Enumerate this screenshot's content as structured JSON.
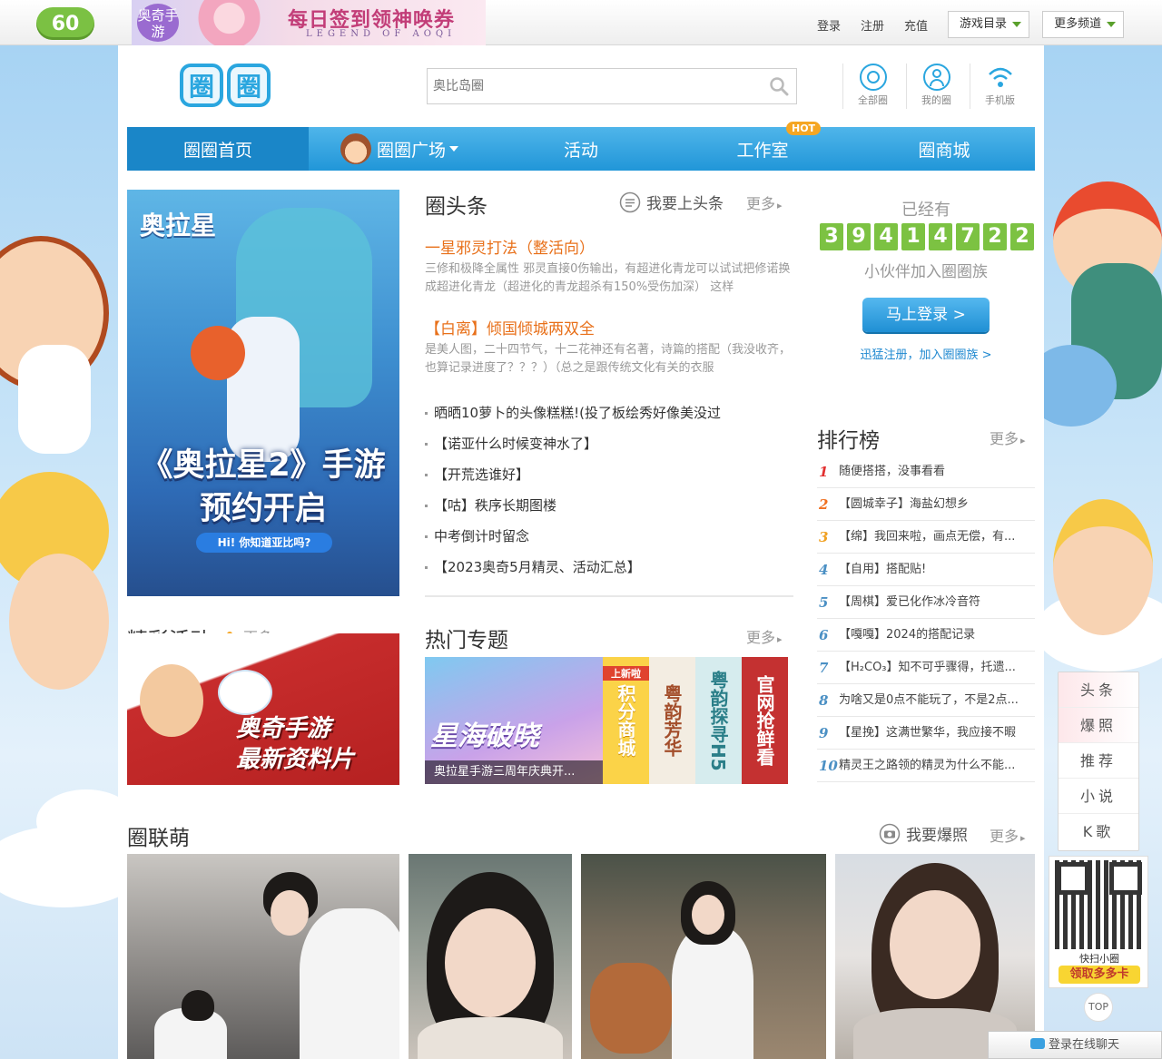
{
  "topbar": {
    "logo_text": "60",
    "banner": {
      "badge": "奥奇手游",
      "slogan": "每日签到领神唤券",
      "sub": "LEGEND OF AOQI"
    },
    "links": [
      "登录",
      "注册",
      "充值"
    ],
    "dropdowns": [
      "游戏目录",
      "更多频道"
    ]
  },
  "header": {
    "logo_chars": [
      "圈",
      "圈"
    ],
    "search_placeholder": "奥比岛圈",
    "quick": [
      {
        "label": "全部圈",
        "icon": "circle-icon"
      },
      {
        "label": "我的圈",
        "icon": "user-icon"
      },
      {
        "label": "手机版",
        "icon": "wifi-icon"
      }
    ]
  },
  "nav": {
    "items": [
      "圈圈首页",
      "圈圈广场",
      "活动",
      "工作室",
      "圈商城"
    ],
    "hot_badge": "HOT"
  },
  "hero": {
    "logo": "奥拉星",
    "headline_1": "《奥拉星2》手游",
    "headline_2": "预约开启",
    "pill": "Hi! 你知道亚比吗?"
  },
  "headlines": {
    "title": "圈头条",
    "submit": "我要上头条",
    "more": "更多",
    "featured": [
      {
        "title": "一星邪灵打法（整活向）",
        "desc": "三修和极降全属性 邪灵直接0伤输出，有超进化青龙可以试试把修诺换成超进化青龙（超进化的青龙超杀有150%受伤加深） 这样"
      },
      {
        "title": "【白离】倾国倾城两双全",
        "desc": "是美人图，二十四节气，十二花神还有名著，诗篇的搭配（我没收齐，也算记录进度了？？？）（总之是跟传统文化有关的衣服"
      }
    ],
    "list": [
      "晒晒10萝卜的头像糕糕!(投了板绘秀好像美没过",
      "【诺亚什么时候变神水了】",
      "【开荒选谁好】",
      "【咕】秩序长期图楼",
      "中考倒计时留念",
      "【2023奥奇5月精灵、活动汇总】"
    ]
  },
  "counter": {
    "label": "已经有",
    "digits": [
      "3",
      "9",
      "4",
      "1",
      "4",
      "7",
      "2",
      "2"
    ],
    "sub": "小伙伴加入圈圈族",
    "login": "马上登录 >",
    "register": "迅猛注册，加入圈圈族 >"
  },
  "ranking": {
    "title": "排行榜",
    "more": "更多",
    "items": [
      {
        "n": "1",
        "t": "随便搭搭，没事看看"
      },
      {
        "n": "2",
        "t": "【圆城幸子】海盐幻想乡"
      },
      {
        "n": "3",
        "t": "【绵】我回来啦，画点无偿，有..."
      },
      {
        "n": "4",
        "t": "【自用】搭配贴!"
      },
      {
        "n": "5",
        "t": "【周棋】爱已化作冰冷音符"
      },
      {
        "n": "6",
        "t": "【嘎嘎】2024的搭配记录"
      },
      {
        "n": "7",
        "t": "【H₂CO₃】知不可乎骤得，托遗..."
      },
      {
        "n": "8",
        "t": "为啥又是0点不能玩了，不是2点..."
      },
      {
        "n": "9",
        "t": "【星挽】这满世繁华，我应接不暇"
      },
      {
        "n": "10",
        "t": "精灵王之路领的精灵为什么不能..."
      }
    ]
  },
  "activity": {
    "title": "精彩活动",
    "more": "更多",
    "banner_text_1": "奥奇手游",
    "banner_text_2": "最新资料片"
  },
  "topics": {
    "title": "热门专题",
    "more": "更多",
    "main_title": "星海破晓",
    "main_caption": "奥拉星手游三周年庆典开...",
    "tiles": [
      {
        "tag": "上新啦",
        "text": "积分商城"
      },
      {
        "text": "粤韵芳华"
      },
      {
        "text": "粤韵探寻H5"
      },
      {
        "text": "官网抢鲜看"
      }
    ]
  },
  "photos": {
    "title": "圈联萌",
    "submit": "我要爆照",
    "more": "更多"
  },
  "side": {
    "items": [
      "头条",
      "爆照",
      "推荐",
      "小说",
      "K歌"
    ],
    "qr_caption": "快扫小圈",
    "qr_button": "领取多多卡",
    "top": "TOP",
    "chat": "登录在线聊天"
  },
  "colors": {
    "accent_blue": "#2aa6df",
    "headline_orange": "#e8701a",
    "counter_green": "#7cc242",
    "hot_badge": "#f5a623"
  }
}
